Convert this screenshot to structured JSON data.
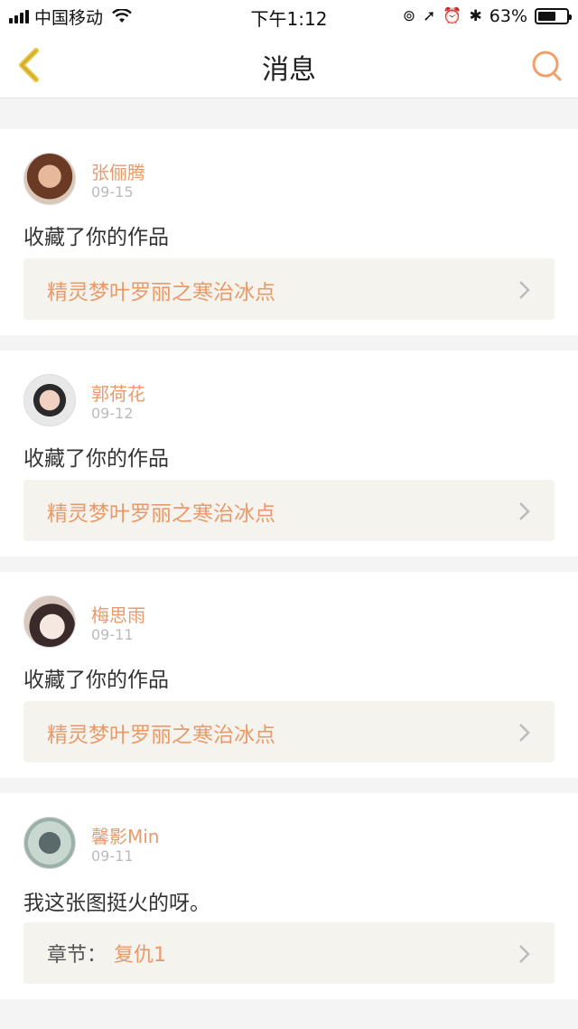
{
  "status_bar": {
    "carrier": "中国移动",
    "time": "下午1:12",
    "battery": "63%",
    "battery_level": 0.63
  },
  "header": {
    "title": "消息",
    "back_icon": "chevron-left-icon",
    "search_icon": "search-icon"
  },
  "colors": {
    "accent": "#e89a6a",
    "back_arrow": "#e8c23a",
    "card_bg": "#f5f3ed",
    "page_bg": "#f4f4f4"
  },
  "messages": [
    {
      "name": "张俪腾",
      "date": "09-15",
      "text": "收藏了你的作品",
      "link_title": "精灵梦叶罗丽之寒治冰点"
    },
    {
      "name": "郭荷花",
      "date": "09-12",
      "text": "收藏了你的作品",
      "link_title": "精灵梦叶罗丽之寒治冰点"
    },
    {
      "name": "梅思雨",
      "date": "09-11",
      "text": "收藏了你的作品",
      "link_title": "精灵梦叶罗丽之寒治冰点"
    },
    {
      "name": "馨影Min",
      "date": "09-11",
      "text": "我这张图挺火的呀。",
      "chapter_label": "章节：",
      "chapter_value": "复仇1"
    }
  ]
}
